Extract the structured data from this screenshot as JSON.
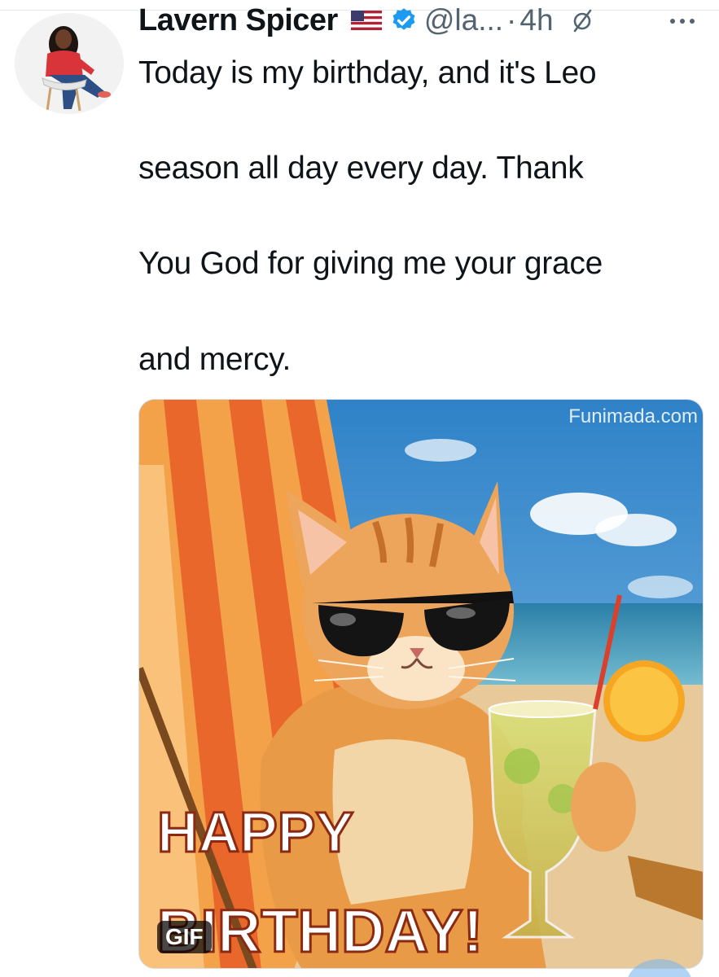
{
  "tweet": {
    "author": {
      "name": "Lavern Spicer",
      "handle": "@la...",
      "flag": "us-flag-icon",
      "verified": "verified-badge-icon"
    },
    "separator": "·",
    "time": "4h",
    "text_lines": [
      "Today is my birthday, and it's Leo",
      " season all day every day.  Thank",
      "You God for giving me your grace",
      "and mercy."
    ],
    "media": {
      "type": "gif",
      "badge": "GIF",
      "watermark": "Funimada.com",
      "caption_line1": "HAPPY",
      "caption_line2": "BIRTHDAY!"
    }
  },
  "colors": {
    "text_primary": "#0f1419",
    "text_secondary": "#536471",
    "verified_blue": "#1d9bf0"
  }
}
